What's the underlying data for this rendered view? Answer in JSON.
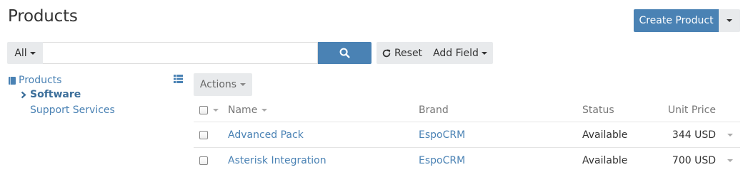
{
  "page": {
    "title": "Products"
  },
  "header_actions": {
    "create_label": "Create Product"
  },
  "search": {
    "filter_label": "All",
    "value": "",
    "placeholder": "",
    "reset_label": "Reset",
    "add_field_label": "Add Field"
  },
  "tree": {
    "root_label": "Products",
    "items": [
      {
        "label": "Software",
        "selected": true
      },
      {
        "label": "Support Services",
        "selected": false
      }
    ]
  },
  "list": {
    "actions_label": "Actions",
    "columns": [
      "Name",
      "Brand",
      "Status",
      "Unit Price"
    ],
    "rows": [
      {
        "name": "Advanced Pack",
        "brand": "EspoCRM",
        "status": "Available",
        "unit_price": "344 USD"
      },
      {
        "name": "Asterisk Integration",
        "brand": "EspoCRM",
        "status": "Available",
        "unit_price": "700 USD"
      }
    ]
  },
  "colors": {
    "primary": "#4a82b4",
    "button_gray": "#e8eaec",
    "link": "#4a82b4"
  },
  "icons": [
    "caret-down-icon",
    "search-icon",
    "refresh-icon",
    "book-icon",
    "chevron-right-icon",
    "list-icon"
  ]
}
